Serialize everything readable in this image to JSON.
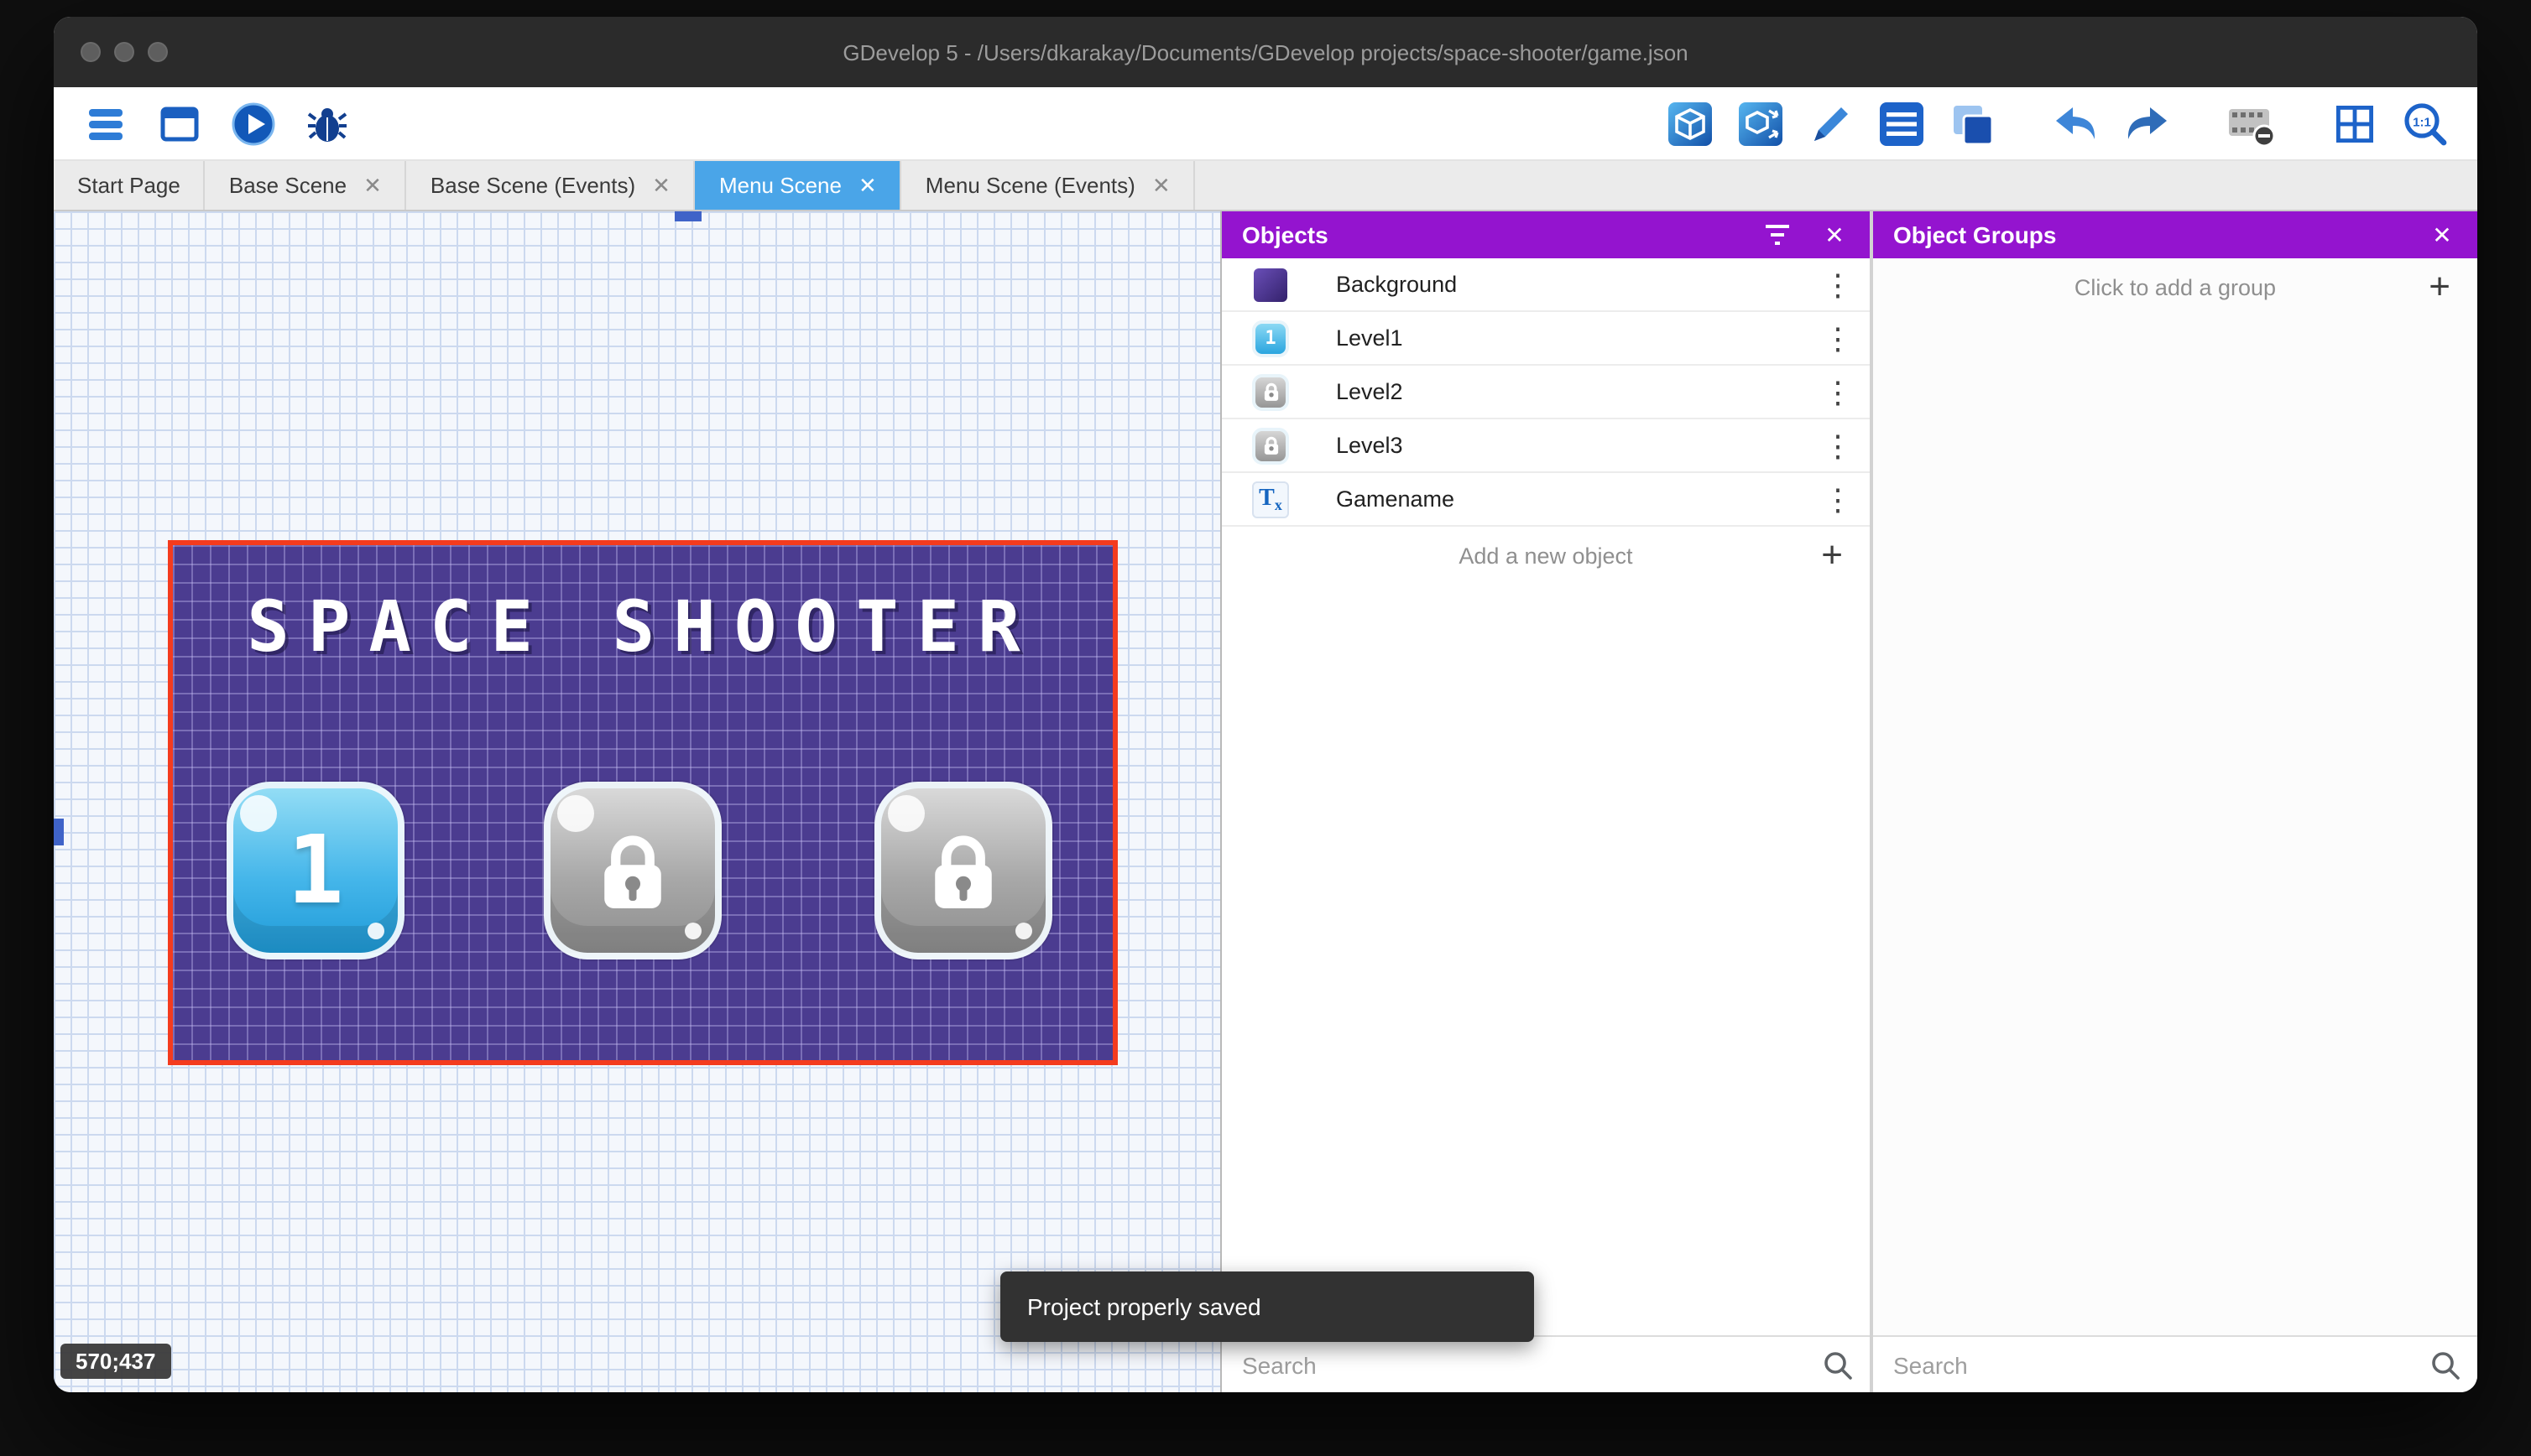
{
  "window": {
    "title": "GDevelop 5 - /Users/dkarakay/Documents/GDevelop projects/space-shooter/game.json"
  },
  "toolbar": {
    "zoom_label": "1:1",
    "left_icons": [
      "project-manager-icon",
      "start-page-icon",
      "preview-play-icon",
      "debug-icon"
    ],
    "right_icons": [
      "objects-editor-icon",
      "object-groups-icon",
      "properties-icon",
      "instances-list-icon",
      "layers-icon",
      "undo-icon",
      "redo-icon",
      "render-options-icon",
      "grid-icon",
      "zoom-icon"
    ]
  },
  "tabs": [
    {
      "label": "Start Page",
      "active": false,
      "closable": false
    },
    {
      "label": "Base Scene",
      "active": false,
      "closable": true
    },
    {
      "label": "Base Scene (Events)",
      "active": false,
      "closable": true
    },
    {
      "label": "Menu Scene",
      "active": true,
      "closable": true
    },
    {
      "label": "Menu Scene (Events)",
      "active": false,
      "closable": true
    }
  ],
  "scene_editor": {
    "cursor_coordinates": "570;437",
    "scene": {
      "title_text": "SPACE SHOOTER",
      "level_buttons": [
        {
          "label": "1",
          "locked": false
        },
        {
          "label": "",
          "locked": true
        },
        {
          "label": "",
          "locked": true
        }
      ]
    }
  },
  "objects_panel": {
    "title": "Objects",
    "items": [
      {
        "name": "Background",
        "icon": "background-swatch"
      },
      {
        "name": "Level1",
        "icon": "level-button-unlocked"
      },
      {
        "name": "Level2",
        "icon": "level-button-locked"
      },
      {
        "name": "Level3",
        "icon": "level-button-locked"
      },
      {
        "name": "Gamename",
        "icon": "text-object"
      }
    ],
    "add_button": "Add a new object",
    "search_placeholder": "Search"
  },
  "object_groups_panel": {
    "title": "Object Groups",
    "add_button": "Click to add a group",
    "search_placeholder": "Search"
  },
  "snackbar": {
    "message": "Project properly saved"
  },
  "icons": {
    "close_x": "✕",
    "overflow_menu": "⋮",
    "plus": "+"
  },
  "colors": {
    "panel_header": "#9414cf",
    "active_tab": "#4aa5e8",
    "selection_border": "#f43b1e",
    "scene_background": "#4b3c90",
    "unlocked_button_blue": "#2aa5df",
    "locked_button_gray": "#a8a8a8",
    "toast_background": "#323232"
  }
}
